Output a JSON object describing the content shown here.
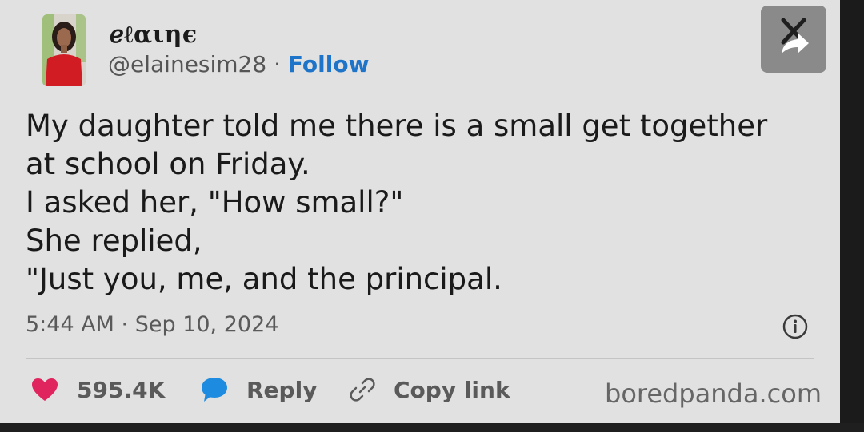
{
  "user": {
    "display_name": "ℯℓαιηє",
    "handle": "@elainesim28",
    "separator": "·",
    "follow_label": "Follow"
  },
  "tweet": {
    "lines": [
      "My daughter told me there is a small get together",
      "at school on Friday.",
      "I asked her, \"How small?\"",
      "She replied,",
      "\"Just you, me, and the principal."
    ],
    "timestamp": "5:44 AM · Sep 10, 2024"
  },
  "actions": {
    "likes_count": "595.4K",
    "reply_label": "Reply",
    "copy_link_label": "Copy link"
  },
  "watermark": "boredpanda.com",
  "icons": {
    "heart": "heart-icon",
    "reply": "speech-bubble-icon",
    "copy_link": "link-icon",
    "info": "info-icon",
    "x_share": "x-share-icon"
  },
  "colors": {
    "card_background": "#e1e1e1",
    "follow": "#1d74c8",
    "heart": "#e0245e",
    "reply_bubble": "#1d8ce0",
    "text": "#1a1a1a",
    "muted": "#5a5a5a"
  }
}
